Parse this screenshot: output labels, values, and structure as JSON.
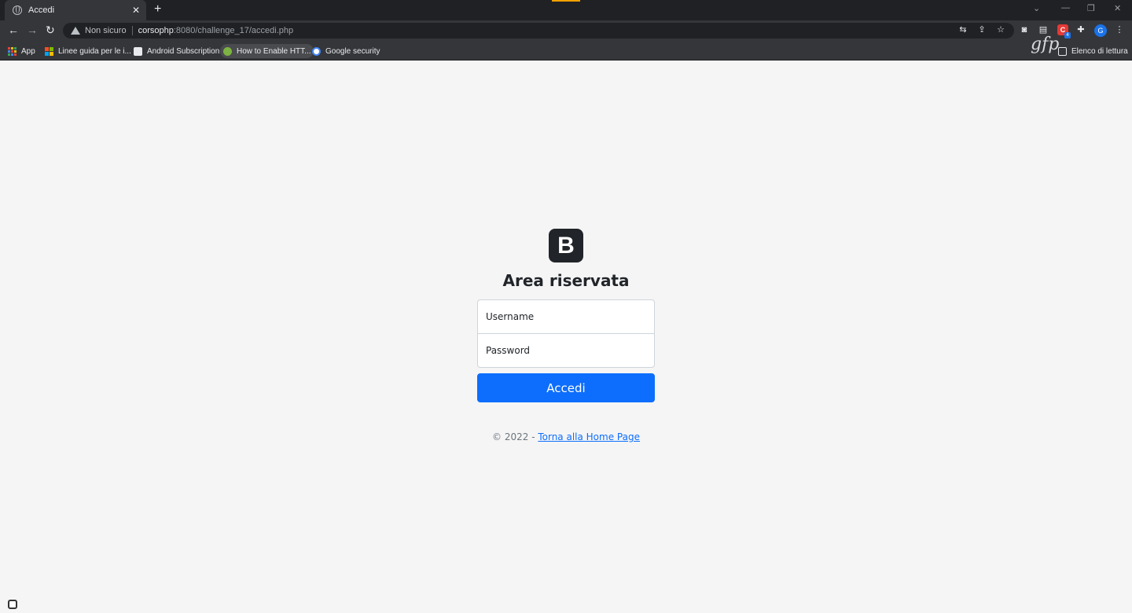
{
  "browser": {
    "tab_title": "Accedi",
    "new_tab_symbol": "+",
    "security_label": "Non sicuro",
    "url_host": "corsophp",
    "url_rest": ":8080/challenge_17/accedi.php",
    "profile_initial": "G",
    "extension_badge": "4",
    "bookmarks": [
      {
        "label": "App",
        "icon": "apps-grid-icon"
      },
      {
        "label": "Linee guida per le i...",
        "icon": "microsoft-icon"
      },
      {
        "label": "Android Subscription",
        "icon": "page-icon"
      },
      {
        "label": "How to Enable HTT...",
        "icon": "site-icon"
      },
      {
        "label": "Google security",
        "icon": "google-icon"
      }
    ],
    "reading_list_label": "Elenco di lettura",
    "watermark": "gfp"
  },
  "page": {
    "brand_letter": "B",
    "heading": "Area riservata",
    "username_placeholder": "Username",
    "password_placeholder": "Password",
    "submit_label": "Accedi",
    "footer_prefix": "© 2022 - ",
    "footer_link": "Torna alla Home Page",
    "accent_color": "#0d6efd"
  }
}
